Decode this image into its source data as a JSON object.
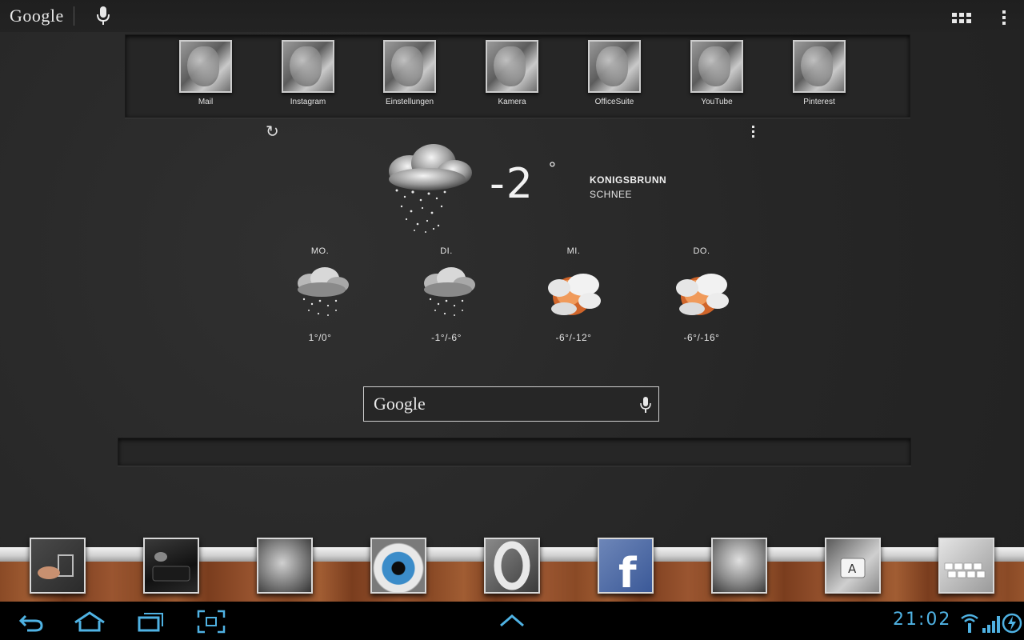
{
  "topbar": {
    "google_label": "Google"
  },
  "apps": [
    {
      "label": "Mail"
    },
    {
      "label": "Instagram"
    },
    {
      "label": "Einstellungen"
    },
    {
      "label": "Kamera"
    },
    {
      "label": "OfficeSuite"
    },
    {
      "label": "YouTube"
    },
    {
      "label": "Pinterest"
    }
  ],
  "weather": {
    "temp": "-2",
    "deg": "°",
    "city": "KONIGSBRUNN",
    "condition": "SCHNEE",
    "forecast": [
      {
        "day": "MO.",
        "range": "1°/0°",
        "icon": "snow-cloud-icon"
      },
      {
        "day": "DI.",
        "range": "-1°/-6°",
        "icon": "snow-cloud-icon"
      },
      {
        "day": "MI.",
        "range": "-6°/-12°",
        "icon": "sun-cloud-icon"
      },
      {
        "day": "DO.",
        "range": "-6°/-16°",
        "icon": "sun-cloud-icon"
      }
    ]
  },
  "search": {
    "google_label": "Google"
  },
  "status": {
    "time": "21:02"
  },
  "colors": {
    "accent": "#4fb2e3",
    "floor": "#8a4a26"
  }
}
